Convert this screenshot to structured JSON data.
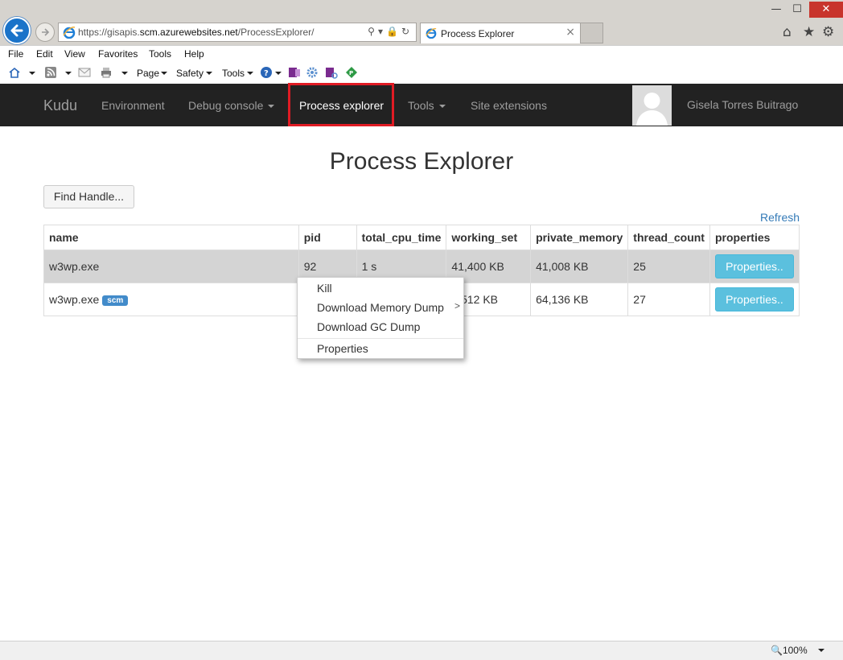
{
  "browser": {
    "url_prefix": "https://gisapis.",
    "url_domain": "scm.azurewebsites.net",
    "url_path": "/ProcessExplorer/",
    "tab_title": "Process Explorer",
    "tab_close": "×",
    "zoom": "100%",
    "window_controls": {
      "minimize": "—",
      "maximize": "☐",
      "close": "✕"
    }
  },
  "menubar": [
    "File",
    "Edit",
    "View",
    "Favorites",
    "Tools",
    "Help"
  ],
  "commandbar": {
    "page": "Page",
    "safety": "Safety",
    "tools": "Tools"
  },
  "kudu_nav": {
    "brand": "Kudu",
    "links": [
      "Environment",
      "Debug console",
      "Process explorer",
      "Tools",
      "Site extensions"
    ],
    "user": "Gisela Torres Buitrago"
  },
  "page": {
    "title": "Process Explorer",
    "find_handle": "Find Handle...",
    "refresh": "Refresh"
  },
  "table": {
    "columns": [
      "name",
      "pid",
      "total_cpu_time",
      "working_set",
      "private_memory",
      "thread_count",
      "properties"
    ],
    "rows": [
      {
        "name": "w3wp.exe",
        "badge": "",
        "pid": "92",
        "total_cpu_time": "1 s",
        "working_set": "41,400 KB",
        "private_memory": "41,008 KB",
        "thread_count": "25",
        "properties": "Properties.."
      },
      {
        "name": "w3wp.exe",
        "badge": "scm",
        "pid": "",
        "total_cpu_time": "",
        "working_set": "3,512 KB",
        "private_memory": "64,136 KB",
        "thread_count": "27",
        "properties": "Properties.."
      }
    ]
  },
  "context_menu": {
    "items": [
      "Kill",
      "Download Memory Dump",
      "Download GC Dump",
      "Properties"
    ],
    "submenu_arrow": ">"
  },
  "colors": {
    "navbar": "#222222",
    "highlight": "#e01b24",
    "info_button": "#5bc0de",
    "badge": "#428bca",
    "link": "#337ab7"
  }
}
